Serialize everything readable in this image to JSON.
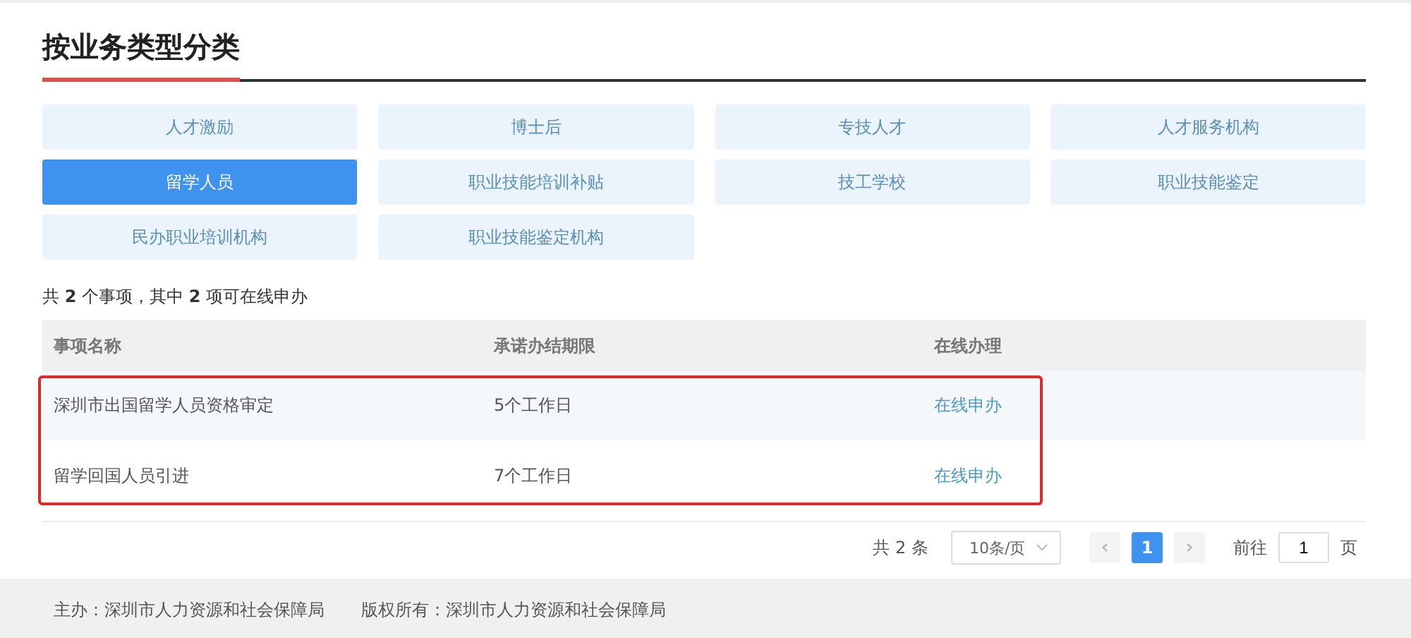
{
  "section": {
    "title": "按业务类型分类"
  },
  "categories": [
    {
      "label": "人才激励",
      "selected": false
    },
    {
      "label": "博士后",
      "selected": false
    },
    {
      "label": "专技人才",
      "selected": false
    },
    {
      "label": "人才服务机构",
      "selected": false
    },
    {
      "label": "留学人员",
      "selected": true
    },
    {
      "label": "职业技能培训补贴",
      "selected": false
    },
    {
      "label": "技工学校",
      "selected": false
    },
    {
      "label": "职业技能鉴定",
      "selected": false
    },
    {
      "label": "民办职业培训机构",
      "selected": false
    },
    {
      "label": "职业技能鉴定机构",
      "selected": false
    }
  ],
  "summary": "共 **2** 个事项，其中 **2** 项可在线申办",
  "table": {
    "columns": [
      "事项名称",
      "承诺办结期限",
      "在线办理"
    ],
    "rows": [
      {
        "name": "深圳市出国留学人员资格审定",
        "deadline": "5个工作日",
        "action": "在线申办",
        "highlighted": true
      },
      {
        "name": "留学回国人员引进",
        "deadline": "7个工作日",
        "action": "在线申办",
        "highlighted": true
      }
    ]
  },
  "pagination": {
    "total": "共 2 条",
    "page_size": "10条/页",
    "prev": "‹",
    "pages": [
      {
        "label": "1",
        "selected": true
      }
    ],
    "next": "›",
    "goto_label": "前往",
    "goto_value": "1",
    "goto_unit": "页"
  },
  "footer": {
    "sponsor": "主办：深圳市人力资源和社会保障局",
    "copyright": "版权所有：深圳市人力资源和社会保障局"
  }
}
